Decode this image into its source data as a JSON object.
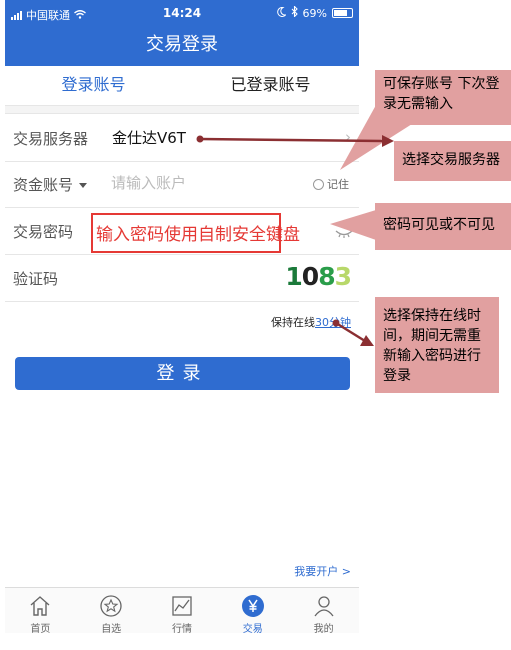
{
  "status_bar": {
    "carrier": "中国联通",
    "time": "14:24",
    "battery": "69%"
  },
  "nav": {
    "title": "交易登录"
  },
  "tabs": [
    {
      "label": "登录账号"
    },
    {
      "label": "已登录账号"
    }
  ],
  "form": {
    "server_label": "交易服务器",
    "server_value": "金仕达V6T",
    "account_label": "资金账号",
    "account_placeholder": "请输入账户",
    "remember_label": "记住",
    "password_label": "交易密码",
    "captcha_label": "验证码",
    "captcha_value": "1083",
    "keep_online_prefix": "保持在线",
    "keep_online_value": "30分钟",
    "login_button": "登录",
    "open_account": "我要开户 >"
  },
  "tabbar": [
    {
      "label": "首页",
      "icon": "home-icon"
    },
    {
      "label": "自选",
      "icon": "star-icon"
    },
    {
      "label": "行情",
      "icon": "chart-icon"
    },
    {
      "label": "交易",
      "icon": "yen-icon"
    },
    {
      "label": "我的",
      "icon": "user-icon"
    }
  ],
  "annotations": {
    "password_hint": "输入密码使用自制安全键盘",
    "save_account": "可保存账号 下次登录无需输入",
    "select_server": "选择交易服务器",
    "password_visibility": "密码可见或不可见",
    "keep_online": "选择保持在线时间，期间无需重新输入密码进行登录"
  },
  "colors": {
    "primary": "#2f6cd0",
    "annotation_bg": "#e1a0a0",
    "annotation_red": "#e53935",
    "arrow": "#8b2f32"
  }
}
